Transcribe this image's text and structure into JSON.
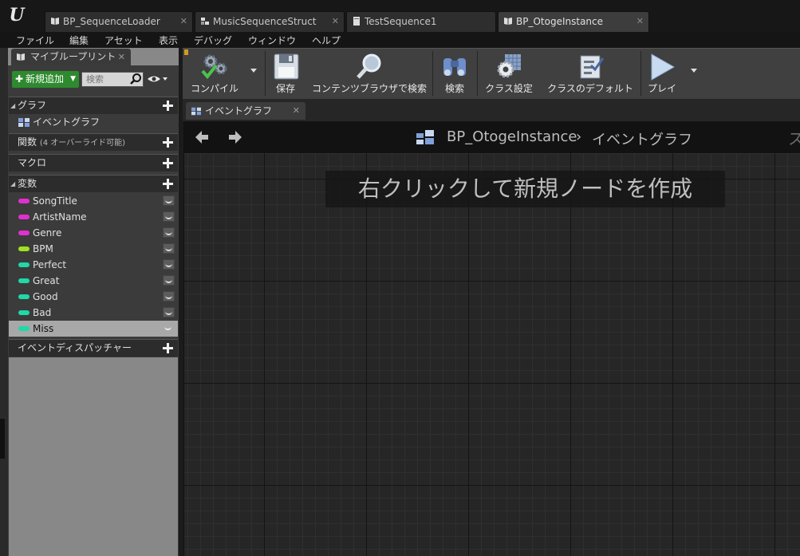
{
  "window": {
    "tabs": [
      {
        "label": "BP_SequenceLoader",
        "icon": "blueprint-book-icon"
      },
      {
        "label": "MusicSequenceStruct",
        "icon": "struct-icon"
      },
      {
        "label": "TestSequence1",
        "icon": "data-table-icon"
      },
      {
        "label": "BP_OtogeInstance",
        "icon": "blueprint-book-icon",
        "active": true
      }
    ],
    "tab_close": "✕"
  },
  "menu": [
    "ファイル",
    "編集",
    "アセット",
    "表示",
    "デバッグ",
    "ウィンドウ",
    "ヘルプ"
  ],
  "my_blueprint": {
    "tab_label": "マイブループリント",
    "add_new_label": "新規追加",
    "search_placeholder": "検索",
    "sections": {
      "graphs": {
        "label": "グラフ",
        "items": [
          "イベントグラフ"
        ]
      },
      "functions": {
        "label": "関数",
        "note": "(4 オーバーライド可能)"
      },
      "macros": {
        "label": "マクロ"
      },
      "variables": {
        "label": "変数",
        "items": [
          {
            "name": "SongTitle",
            "type_color": "#e030d0"
          },
          {
            "name": "ArtistName",
            "type_color": "#e030d0"
          },
          {
            "name": "Genre",
            "type_color": "#e030d0"
          },
          {
            "name": "BPM",
            "type_color": "#a0e020"
          },
          {
            "name": "Perfect",
            "type_color": "#20d8a8"
          },
          {
            "name": "Great",
            "type_color": "#20d8a8"
          },
          {
            "name": "Good",
            "type_color": "#20d8a8"
          },
          {
            "name": "Bad",
            "type_color": "#20d8a8"
          },
          {
            "name": "Miss",
            "type_color": "#20d8a8",
            "selected": true
          }
        ]
      },
      "dispatchers": {
        "label": "イベントディスパッチャー"
      }
    }
  },
  "toolbar": {
    "compile": "コンパイル",
    "save": "保存",
    "browse": "コンテンツブラウザで検索",
    "find": "検索",
    "class_settings": "クラス設定",
    "class_defaults": "クラスのデフォルト",
    "play": "プレイ"
  },
  "graph": {
    "tab_label": "イベントグラフ",
    "breadcrumb_blueprint": "BP_OtogeInstance",
    "breadcrumb_separator": "›",
    "breadcrumb_graph": "イベントグラフ",
    "right_label": "ス",
    "hint": "右クリックして新規ノードを作成"
  },
  "colors": {
    "add_button": "#2e8a2e",
    "toolbar_accent": "#d49a1e"
  }
}
